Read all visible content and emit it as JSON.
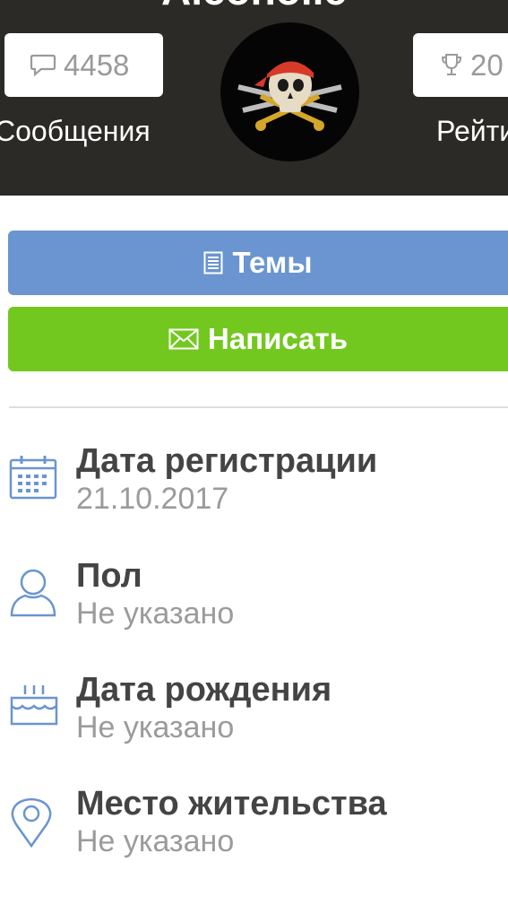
{
  "profile": {
    "username": "Alcoholic",
    "messages_count": "4458",
    "messages_label": "Сообщения",
    "rating_count": "20",
    "rating_label": "Рейтинг"
  },
  "actions": {
    "topics_label": "Темы",
    "write_label": "Написать"
  },
  "info": [
    {
      "title": "Дата регистрации",
      "value": "21.10.2017",
      "icon": "calendar-icon"
    },
    {
      "title": "Пол",
      "value": "Не указано",
      "icon": "user-icon"
    },
    {
      "title": "Дата рождения",
      "value": "Не указано",
      "icon": "birthday-cake-icon"
    },
    {
      "title": "Место жительства",
      "value": "Не указано",
      "icon": "location-pin-icon"
    }
  ],
  "colors": {
    "header_bg": "#2c2a27",
    "topics_button": "#6a95d0",
    "write_button": "#73c81f",
    "icon_blue": "#6a95d0"
  }
}
